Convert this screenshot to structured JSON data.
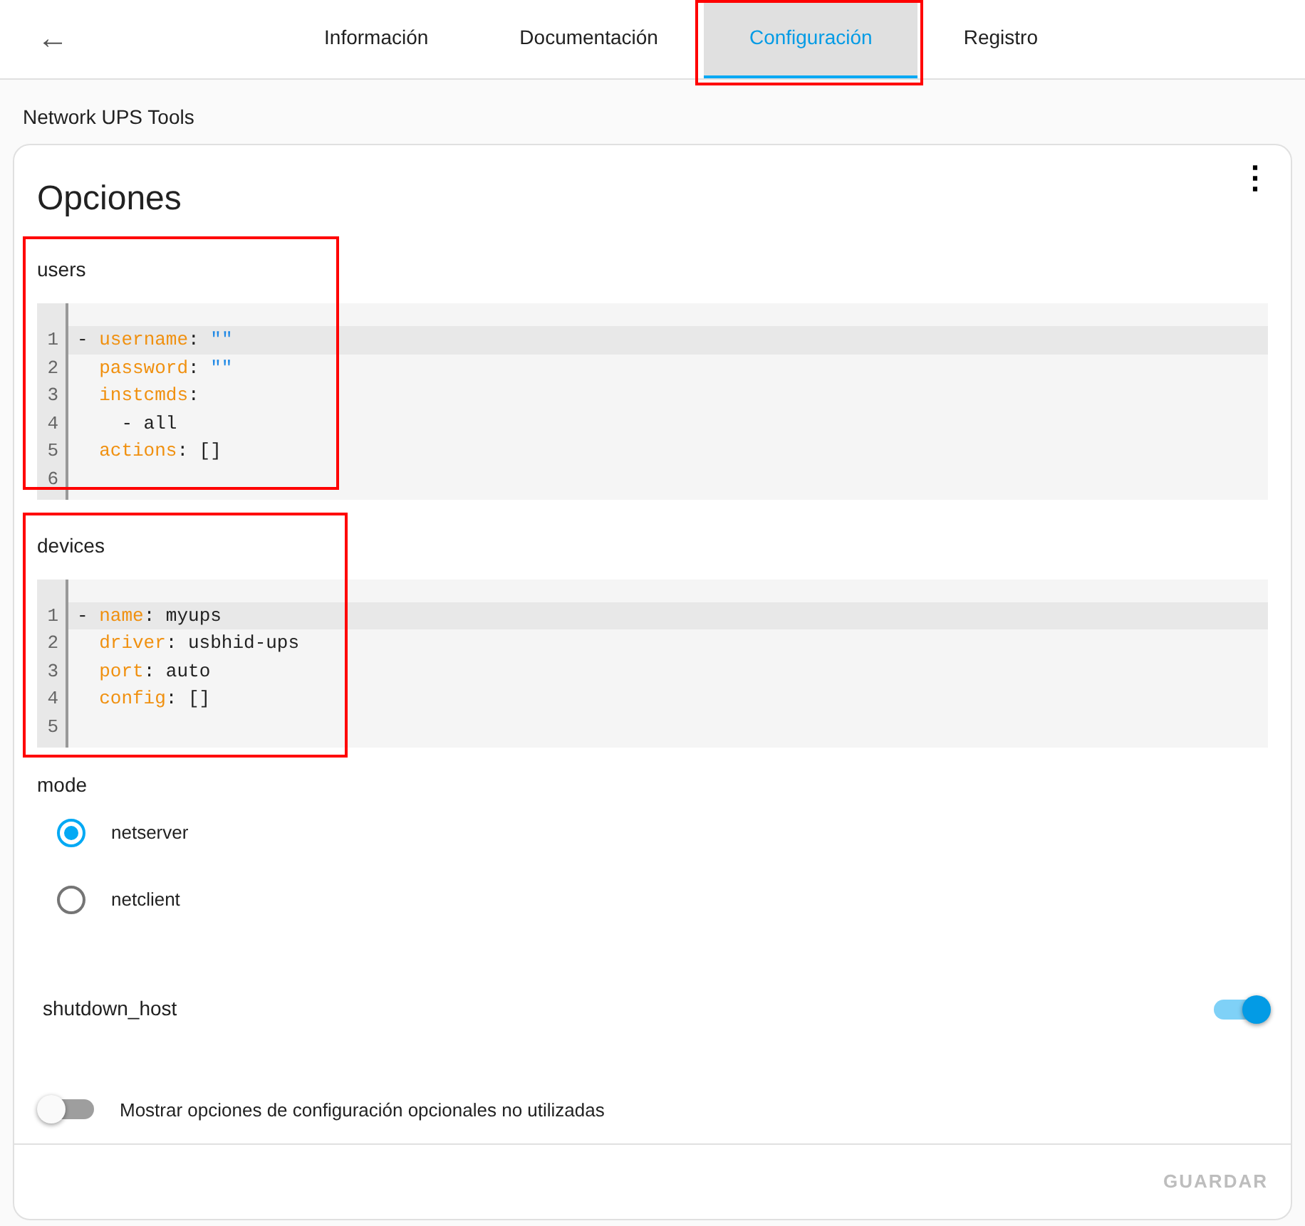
{
  "header": {
    "back": "←",
    "tabs": [
      {
        "label": "Información",
        "selected": false,
        "highlighted": false
      },
      {
        "label": "Documentación",
        "selected": false,
        "highlighted": false
      },
      {
        "label": "Configuración",
        "selected": true,
        "highlighted": true
      },
      {
        "label": "Registro",
        "selected": false,
        "highlighted": false
      }
    ]
  },
  "page_title": "Network UPS Tools",
  "card": {
    "title": "Opciones",
    "menu": "⋮",
    "code_fields": [
      {
        "label": "users",
        "highlighted": true,
        "lines": [
          {
            "number": "1",
            "active": true,
            "segments": [
              {
                "kind": "plain",
                "text": "- "
              },
              {
                "kind": "key",
                "text": "username"
              },
              {
                "kind": "plain",
                "text": ": "
              },
              {
                "kind": "string",
                "text": "\"\""
              }
            ]
          },
          {
            "number": "2",
            "active": false,
            "nested": true,
            "segments": [
              {
                "kind": "key",
                "text": "password"
              },
              {
                "kind": "plain",
                "text": ": "
              },
              {
                "kind": "string",
                "text": "\"\""
              }
            ]
          },
          {
            "number": "3",
            "active": false,
            "nested": true,
            "segments": [
              {
                "kind": "key",
                "text": "instcmds"
              },
              {
                "kind": "plain",
                "text": ":"
              }
            ]
          },
          {
            "number": "4",
            "active": false,
            "nested": true,
            "segments": [
              {
                "kind": "plain",
                "text": "  - all"
              }
            ]
          },
          {
            "number": "5",
            "active": false,
            "nested": true,
            "segments": [
              {
                "kind": "key",
                "text": "actions"
              },
              {
                "kind": "plain",
                "text": ": []"
              }
            ]
          },
          {
            "number": "6",
            "active": false
          }
        ]
      },
      {
        "label": "devices",
        "highlighted": true,
        "lines": [
          {
            "number": "1",
            "active": true,
            "segments": [
              {
                "kind": "plain",
                "text": "- "
              },
              {
                "kind": "key",
                "text": "name"
              },
              {
                "kind": "plain",
                "text": ": myups"
              }
            ]
          },
          {
            "number": "2",
            "active": false,
            "nested": true,
            "segments": [
              {
                "kind": "key",
                "text": "driver"
              },
              {
                "kind": "plain",
                "text": ": usbhid-ups"
              }
            ]
          },
          {
            "number": "3",
            "active": false,
            "nested": true,
            "segments": [
              {
                "kind": "key",
                "text": "port"
              },
              {
                "kind": "plain",
                "text": ": auto"
              }
            ]
          },
          {
            "number": "4",
            "active": false,
            "nested": true,
            "segments": [
              {
                "kind": "key",
                "text": "config"
              },
              {
                "kind": "plain",
                "text": ": []"
              }
            ]
          },
          {
            "number": "5",
            "active": false
          }
        ]
      }
    ],
    "mode": {
      "label": "mode",
      "options": [
        {
          "label": "netserver",
          "selected": true
        },
        {
          "label": "netclient",
          "selected": false
        }
      ]
    },
    "shutdown_host": {
      "label": "shutdown_host",
      "on": true
    },
    "show_unused": {
      "label": "Mostrar opciones de configuración opcionales no utilizadas",
      "on": false
    },
    "save_button": {
      "label": "GUARDAR",
      "disabled": true
    }
  }
}
